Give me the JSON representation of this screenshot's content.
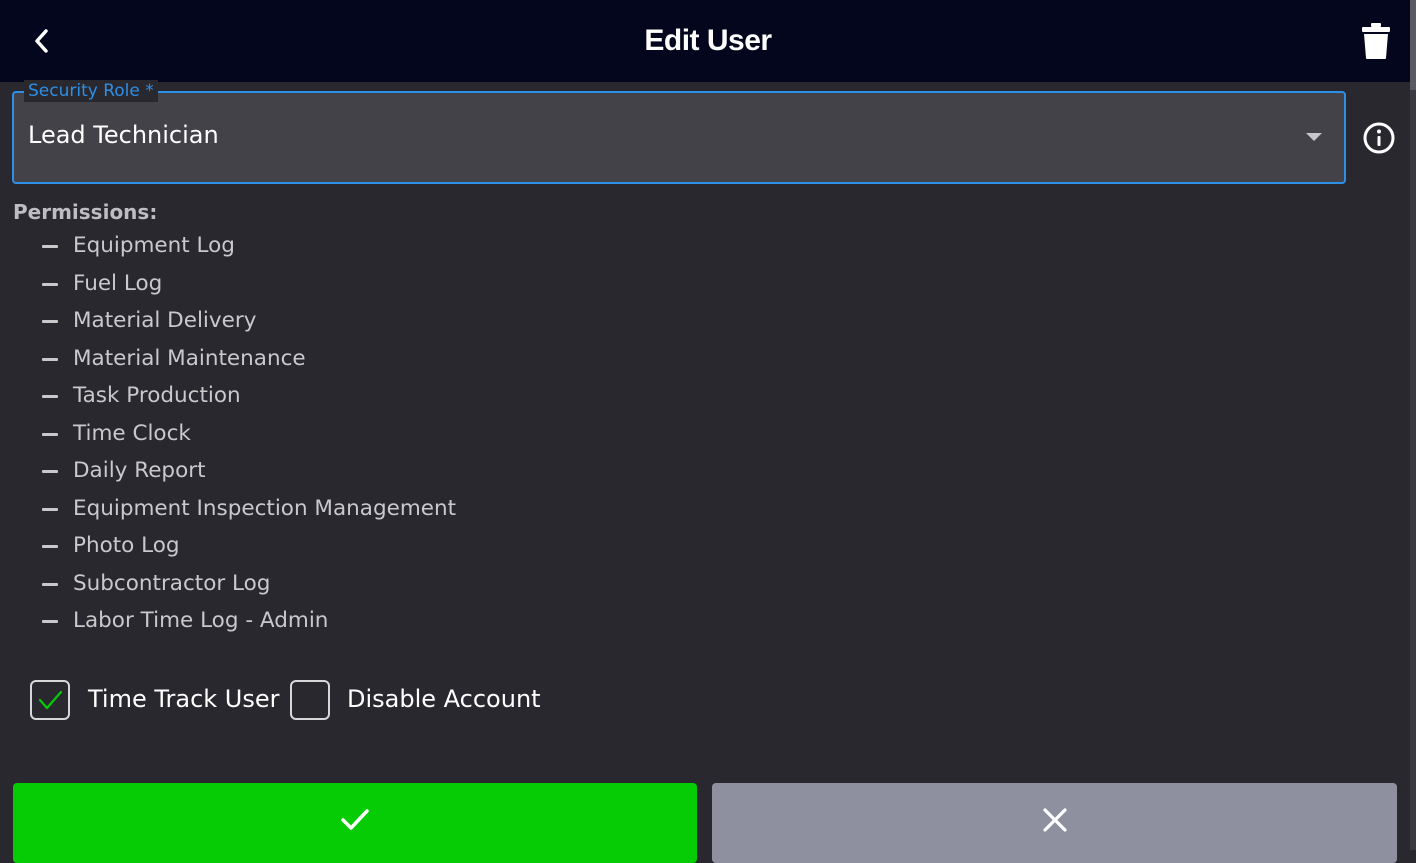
{
  "header": {
    "title": "Edit User",
    "back_icon": "chevron-left-icon",
    "delete_icon": "trash-icon"
  },
  "security_role": {
    "label": "Security Role *",
    "value": "Lead Technician",
    "dropdown_icon": "caret-down-icon",
    "info_icon": "info-circle-icon"
  },
  "permissions": {
    "heading": "Permissions:",
    "items": [
      "Equipment Log",
      "Fuel Log",
      "Material Delivery",
      "Material Maintenance",
      "Task Production",
      "Time Clock",
      "Daily Report",
      "Equipment Inspection Management",
      "Photo Log",
      "Subcontractor Log",
      "Labor Time Log - Admin"
    ]
  },
  "options": {
    "time_track_user": {
      "label": "Time Track User",
      "checked": true
    },
    "disable_account": {
      "label": "Disable Account",
      "checked": false
    }
  },
  "actions": {
    "save_icon": "check-icon",
    "cancel_icon": "close-icon"
  },
  "colors": {
    "header_bg": "#03061c",
    "page_bg": "#29282e",
    "accent": "#2e8fe6",
    "save": "#06cc06",
    "cancel": "#8e90a0",
    "check_mark": "#06cc06"
  }
}
